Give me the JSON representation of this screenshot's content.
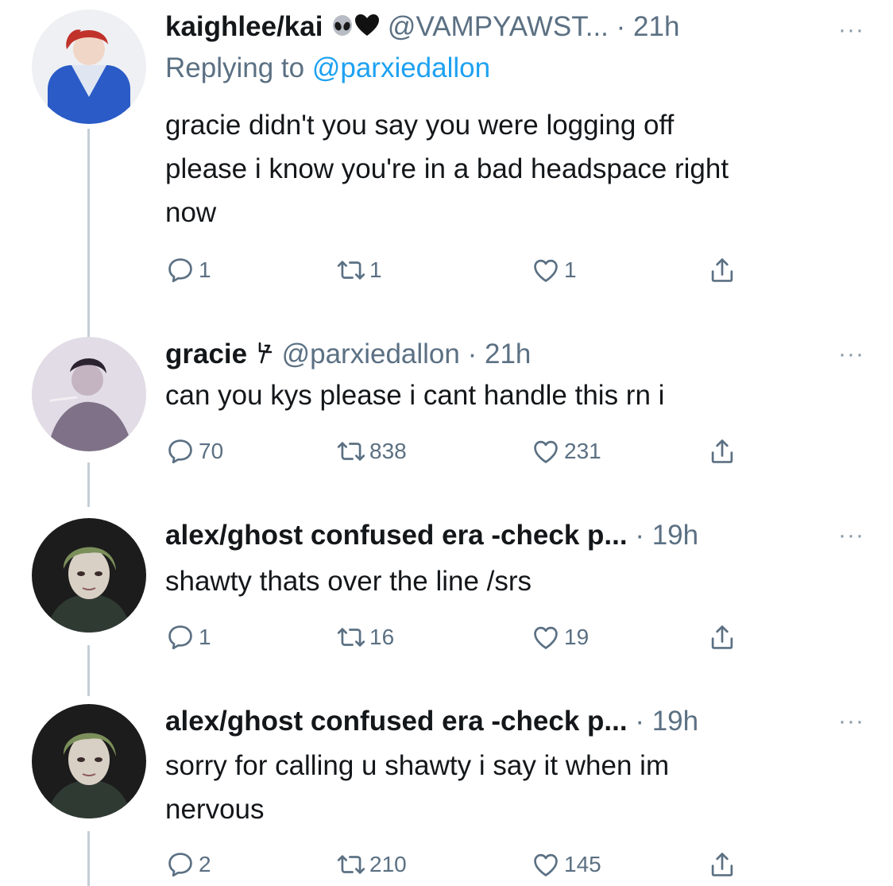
{
  "tweets": [
    {
      "name": "kaighlee/kai",
      "emoji": [
        "alien-emoji",
        "black-heart-emoji"
      ],
      "handle": "@VAMPYAWST...",
      "time": "21h",
      "dot": "·",
      "more": "···",
      "replying_prefix": "Replying to ",
      "replying_handle": "@parxiedallon",
      "text_lines": [
        "gracie didn't you say you were logging off",
        "please i know you're in a bad headspace right",
        "now"
      ],
      "replies": "1",
      "retweets": "1",
      "likes": "1"
    },
    {
      "name": "gracie",
      "emoji": [
        "lightning-symbol"
      ],
      "handle": "@parxiedallon",
      "time": "21h",
      "dot": "·",
      "more": "···",
      "text_lines": [
        "can you kys please i cant handle this rn i"
      ],
      "replies": "70",
      "retweets": "838",
      "likes": "231"
    },
    {
      "name": "alex/ghost confused era -check p...",
      "handle": "",
      "time": "19h",
      "dot": "·",
      "more": "···",
      "text_lines": [
        "shawty thats over the line /srs"
      ],
      "replies": "1",
      "retweets": "16",
      "likes": "19"
    },
    {
      "name": "alex/ghost confused era -check p...",
      "handle": "",
      "time": "19h",
      "dot": "·",
      "more": "···",
      "text_lines": [
        "sorry for calling u shawty i say it when im",
        "nervous"
      ],
      "replies": "2",
      "retweets": "210",
      "likes": "145"
    }
  ],
  "colors": {
    "text": "#14171a",
    "muted": "#5b7083",
    "link": "#1da1f2",
    "thread_line": "#c4cfd6"
  },
  "icons": [
    "reply-icon",
    "retweet-icon",
    "like-icon",
    "share-icon"
  ]
}
